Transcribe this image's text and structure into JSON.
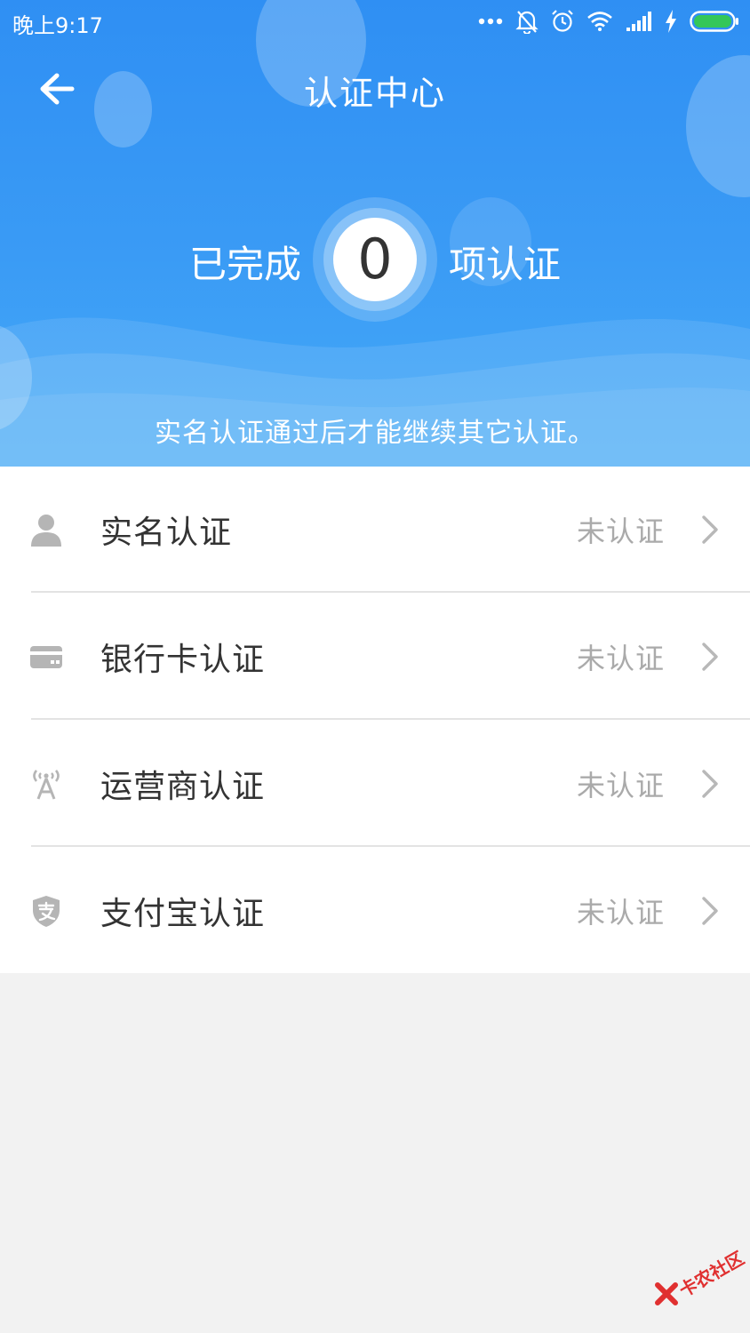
{
  "status_bar": {
    "time": "晚上9:17"
  },
  "header": {
    "title": "认证中心",
    "counter_prefix": "已完成",
    "counter_value": "0",
    "counter_suffix": "项认证",
    "notice": "实名认证通过后才能继续其它认证。"
  },
  "items": [
    {
      "label": "实名认证",
      "status": "未认证",
      "icon": "person-icon"
    },
    {
      "label": "银行卡认证",
      "status": "未认证",
      "icon": "bank-card-icon"
    },
    {
      "label": "运营商认证",
      "status": "未认证",
      "icon": "signal-tower-icon"
    },
    {
      "label": "支付宝认证",
      "status": "未认证",
      "icon": "alipay-shield-icon"
    }
  ],
  "watermark": "卡农社区",
  "colors": {
    "header_blue": "#2f8ff3",
    "icon_gray": "#b5b5b5",
    "battery_green": "#34c759"
  }
}
